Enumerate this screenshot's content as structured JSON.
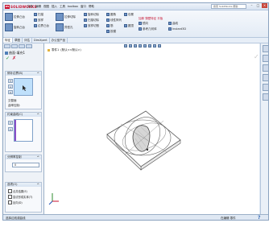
{
  "app": {
    "logo_letters": "DS",
    "logo_name": "SOLIDWORKS"
  },
  "menu": [
    "文件",
    "编辑",
    "视图",
    "插入",
    "工具",
    "toolbox",
    "窗口",
    "帮助"
  ],
  "search": {
    "placeholder": "搜索 SolidWorks 帮助"
  },
  "window_buttons": {
    "minimize": "–",
    "maximize": "□",
    "close": "×"
  },
  "ribbon": {
    "highlight_label": "加厚 薄壁特征 平板",
    "buttons": [
      "拉伸凸台",
      "旋转凸台",
      "扫描",
      "放样",
      "边界凸台",
      "拉伸切除",
      "异型孔",
      "旋转切除",
      "扫描切除",
      "放样切割",
      "圆角",
      "线性阵列",
      "筋",
      "拔模",
      "包覆",
      "圆顶",
      "镜向",
      "参考几何体",
      "曲线",
      "Instant3D"
    ]
  },
  "command_tabs": [
    "特征",
    "草图",
    "评估",
    "DimXpert",
    "办公室产品"
  ],
  "left_panel": {
    "title": "曲面-填充1",
    "ok": "✓",
    "cancel": "✗",
    "groups": {
      "boundary": "修补边界(B)",
      "boundary_btns": [
        "↑",
        "↓",
        "x"
      ],
      "edge_settings": "交替面",
      "curvature_label": "曲率控制:",
      "constraint_curves": "约束曲线(C)",
      "constraint_btns": [
        "↑",
        "↓"
      ],
      "resolution": "分辨率控制",
      "resolution_value": "0",
      "options": "选项(O)",
      "option_items": [
        "合并结果(E)",
        "尝试形成实体(T)",
        "反向(D)"
      ]
    }
  },
  "viewport": {
    "breadcrumb": [
      "零件1",
      "(默认<<默认>)"
    ],
    "check_mark": "✓"
  },
  "status": {
    "left": "选择边线或曲线",
    "right": "在编辑 零件",
    "help": "?"
  },
  "colors": {
    "accent": "#c8102e",
    "ok_green": "#1f9a2a",
    "purple": "#8a4fc8",
    "selection_blue": "#bfe0fb"
  }
}
